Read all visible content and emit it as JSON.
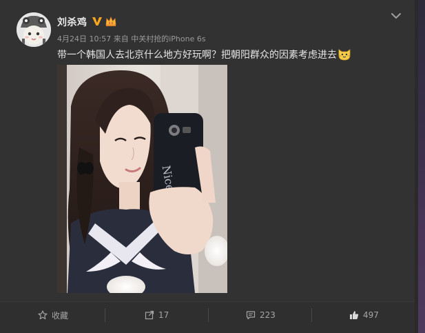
{
  "post": {
    "author": {
      "name": "刘杀鸡",
      "avatar_icon": "avatar-cat-hat"
    },
    "meta": {
      "date": "4月24日 10:57",
      "from_label": "来自",
      "source": "中关村抢的iPhone 6s"
    },
    "text": "带一个韩国人去北京什么地方好玩啊？把朝阳群众的因素考虑进去",
    "emoji_icon": "cat-emoji"
  },
  "actions": {
    "favorite_label": "收藏",
    "repost_count": "17",
    "comment_count": "223",
    "like_count": "497"
  },
  "colors": {
    "verified_badge": "#f5a623",
    "background": "#323232",
    "text": "#e5e5e5",
    "meta_text": "#9a9a9a"
  }
}
